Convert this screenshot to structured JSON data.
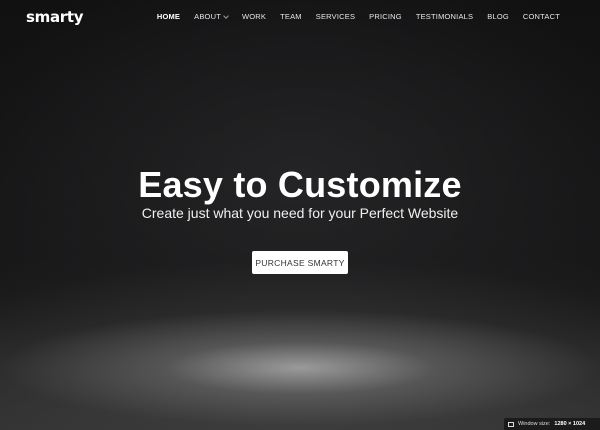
{
  "header": {
    "logo": "smarty",
    "nav": [
      {
        "label": "HOME",
        "active": true
      },
      {
        "label": "ABOUT",
        "dropdown": true
      },
      {
        "label": "WORK"
      },
      {
        "label": "TEAM"
      },
      {
        "label": "SERVICES"
      },
      {
        "label": "PRICING"
      },
      {
        "label": "TESTIMONIALS"
      },
      {
        "label": "BLOG"
      },
      {
        "label": "CONTACT"
      }
    ]
  },
  "hero": {
    "title": "Easy to Customize",
    "subtitle": "Create just what you need for your Perfect Website",
    "cta_label": "PURCHASE SMARTY"
  },
  "status": {
    "window_size_label": "Window size:",
    "window_size_value": "1280 × 1024"
  }
}
